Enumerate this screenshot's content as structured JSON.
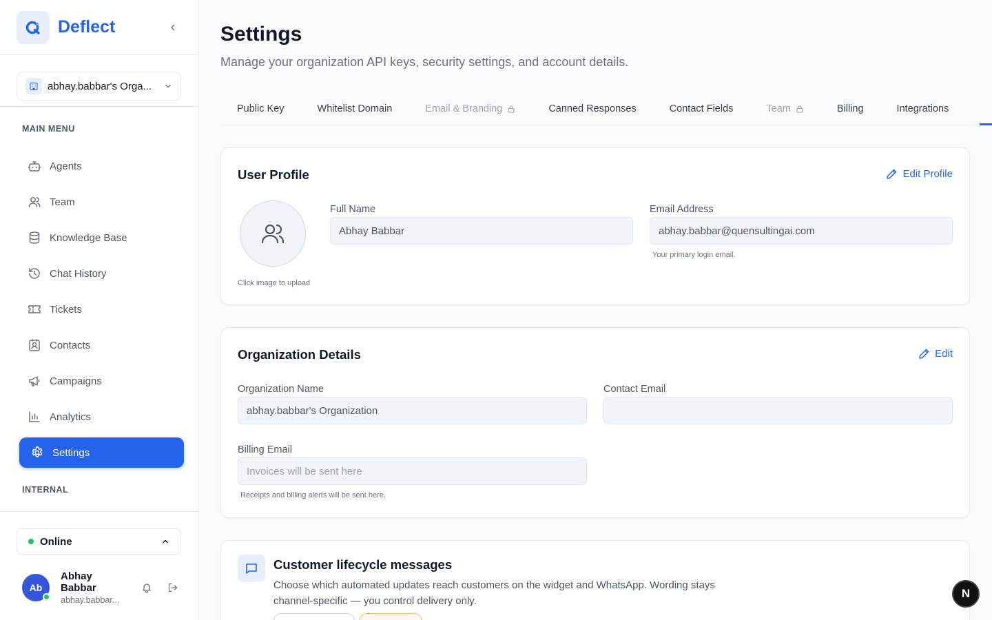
{
  "brand": {
    "name": "Deflect"
  },
  "organization": {
    "name": "abhay.babbar's Orga..."
  },
  "sidebar": {
    "main_menu_title": "MAIN MENU",
    "internal_title": "INTERNAL",
    "items": [
      {
        "label": "Agents",
        "icon": "bot-icon"
      },
      {
        "label": "Team",
        "icon": "users-icon"
      },
      {
        "label": "Knowledge Base",
        "icon": "database-icon"
      },
      {
        "label": "Chat History",
        "icon": "history-icon"
      },
      {
        "label": "Tickets",
        "icon": "ticket-icon"
      },
      {
        "label": "Contacts",
        "icon": "contact-icon"
      },
      {
        "label": "Campaigns",
        "icon": "megaphone-icon"
      },
      {
        "label": "Analytics",
        "icon": "chart-icon"
      },
      {
        "label": "Settings",
        "icon": "gear-icon",
        "active": true
      }
    ]
  },
  "status": {
    "label": "Online",
    "color": "#22c55e"
  },
  "user": {
    "initials": "Ab",
    "name": "Abhay Babbar",
    "email": "abhay.babbar..."
  },
  "page": {
    "title": "Settings",
    "subtitle": "Manage your organization API keys, security settings, and account details."
  },
  "tabs": [
    {
      "label": "Public Key",
      "locked": false
    },
    {
      "label": "Whitelist Domain",
      "locked": false
    },
    {
      "label": "Email & Branding",
      "locked": true
    },
    {
      "label": "Canned Responses",
      "locked": false
    },
    {
      "label": "Contact Fields",
      "locked": false
    },
    {
      "label": "Team",
      "locked": true
    },
    {
      "label": "Billing",
      "locked": false
    },
    {
      "label": "Integrations",
      "locked": false
    }
  ],
  "user_profile": {
    "title": "User Profile",
    "edit_label": "Edit Profile",
    "upload_hint": "Click image to upload",
    "full_name_label": "Full Name",
    "full_name_value": "Abhay Babbar",
    "email_label": "Email Address",
    "email_value": "abhay.babbar@quensultingai.com",
    "email_hint": "Your primary login email."
  },
  "organization_details": {
    "title": "Organization Details",
    "edit_label": "Edit",
    "org_name_label": "Organization Name",
    "org_name_value": "abhay.babbar's Organization",
    "contact_email_label": "Contact Email",
    "contact_email_value": "",
    "billing_email_label": "Billing Email",
    "billing_email_placeholder": "Invoices will be sent here",
    "billing_email_hint": "Receipts and billing alerts will be sent here."
  },
  "lifecycle": {
    "title": "Customer lifecycle messages",
    "description": "Choose which automated updates reach customers on the widget and WhatsApp. Wording stays channel-specific — you control delivery only."
  },
  "floating_badge": {
    "label": "N"
  },
  "colors": {
    "accent": "#2563eb",
    "online": "#22c55e"
  }
}
